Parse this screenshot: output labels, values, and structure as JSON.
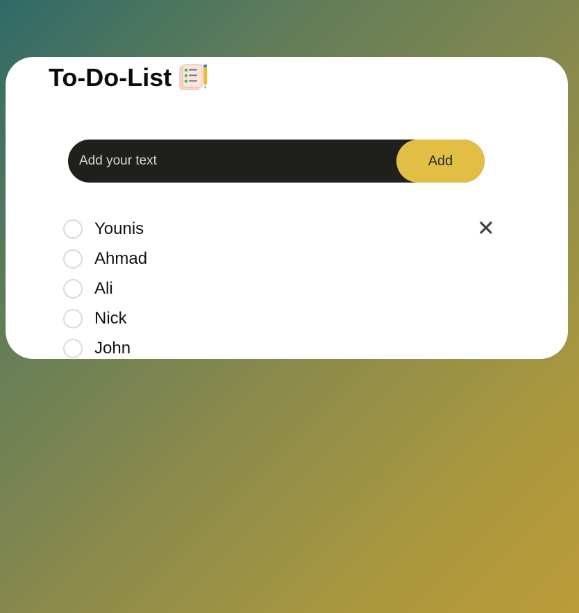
{
  "header": {
    "title": "To-Do-List",
    "title_icon": "checklist-notepad-pencil-icon"
  },
  "input": {
    "placeholder": "Add your text",
    "value": "",
    "add_label": "Add"
  },
  "tasks": [
    {
      "label": "Younis",
      "checked": false
    },
    {
      "label": "Ahmad",
      "checked": false
    },
    {
      "label": "Ali",
      "checked": false
    },
    {
      "label": "Nick",
      "checked": false
    },
    {
      "label": "John",
      "checked": false
    }
  ],
  "colors": {
    "accent": "#e2be45",
    "input_bg": "#1f1f1b",
    "card_bg": "#ffffff",
    "gradient_start": "#2f6a68",
    "gradient_end": "#bb9c38"
  },
  "icons": {
    "remove": "close-icon",
    "unchecked": "circle-outline-icon"
  }
}
